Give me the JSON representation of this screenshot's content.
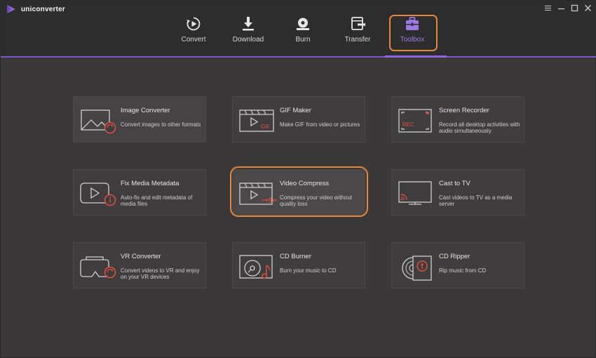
{
  "app": {
    "name": "uniconverter"
  },
  "window": {
    "controls": [
      "menu",
      "minimize",
      "maximize",
      "close"
    ]
  },
  "nav": {
    "items": [
      {
        "label": "Convert",
        "icon": "convert-icon"
      },
      {
        "label": "Download",
        "icon": "download-icon"
      },
      {
        "label": "Burn",
        "icon": "burn-icon"
      },
      {
        "label": "Transfer",
        "icon": "transfer-icon"
      },
      {
        "label": "Toolbox",
        "icon": "toolbox-icon",
        "active": true
      }
    ]
  },
  "toolbox": {
    "tools": [
      {
        "title": "Image Converter",
        "desc": "Convert images to other formats",
        "icon": "image-converter-icon"
      },
      {
        "title": "GIF Maker",
        "desc": "Make GIF from video or pictures",
        "icon": "gif-maker-icon"
      },
      {
        "title": "Screen Recorder",
        "desc": "Record all desktop activities with audio simultaneously",
        "icon": "screen-recorder-icon"
      },
      {
        "title": "Fix Media Metadata",
        "desc": "Auto-fix and edit metadata of media files",
        "icon": "fix-metadata-icon"
      },
      {
        "title": "Video Compress",
        "desc": "Compress your video without quality loss",
        "icon": "video-compress-icon",
        "highlighted": true
      },
      {
        "title": "Cast to TV",
        "desc": "Cast videos to TV as a media server",
        "icon": "cast-tv-icon"
      },
      {
        "title": "VR Converter",
        "desc": "Convert videos to VR and enjoy on your VR devices",
        "icon": "vr-converter-icon"
      },
      {
        "title": "CD Burner",
        "desc": "Burn your music to CD",
        "icon": "cd-burner-icon"
      },
      {
        "title": "CD Ripper",
        "desc": "Rip music from CD",
        "icon": "cd-ripper-icon"
      }
    ]
  },
  "icon_labels": {
    "gif": "GIF",
    "rec": "REC"
  },
  "colors": {
    "accent_purple": "#8d66dc",
    "highlight_orange": "#e7873e",
    "icon_red": "#e0503c"
  }
}
